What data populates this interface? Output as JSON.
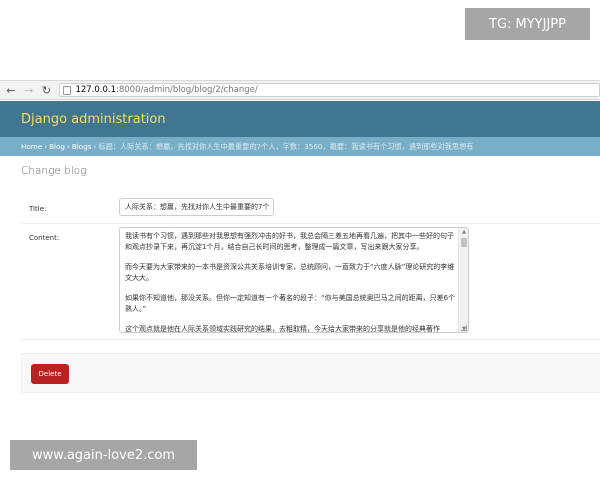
{
  "browser": {
    "back_icon": "←",
    "forward_icon": "→",
    "reload_icon": "↻",
    "url_host": "127.0.0.1",
    "url_path": ":8000/admin/blog/blog/2/change/"
  },
  "header": {
    "brand": "Django administration"
  },
  "breadcrumbs": {
    "items": [
      "Home",
      "Blog",
      "Blogs"
    ],
    "current": "标题：人际关系：想赢，先找对你人生中最重要的7个人，字数：3560，概要：我读书有个习惯，遇到那些对我思想有"
  },
  "main": {
    "page_title": "Change blog"
  },
  "form": {
    "title_label": "Title:",
    "title_value": "人际关系：想赢，先找对你人生中最重要的7个",
    "content_label": "Content:",
    "content_paragraphs": [
      "我读书有个习惯，遇到那些对我思想有强烈冲击的好书，我总会隔三差五地再看几遍，把其中一些好的句子和观点抄录下来，再沉淀1个月，结合自己长时间的思考，整理成一篇文章，写出来跟大家分享。",
      "而今天要为大家带来的一本书是资深公共关系培训专家，总统顾问，一直致力于“六度人脉”理论研究的李维文大大。",
      "如果你不知道他，那没关系。但你一定知道有一个著名的段子：“你与美国总统奥巴马之间的距离，只差6个熟人。”",
      "这个观点就是他在人际关系领域实践研究的结果，去粗取精，今天给大家带来的分享就是他的经典著作"
    ],
    "scroll_up": "▲",
    "scroll_down": "▼"
  },
  "actions": {
    "delete_label": "Delete"
  },
  "watermarks": {
    "top": "TG: MYYJJPP",
    "bottom": "www.again-love2.com"
  },
  "colors": {
    "header_bg": "#417690",
    "brand_text": "#f5dd5d",
    "breadcrumbs_bg": "#79aec8",
    "delete_bg": "#ba2121"
  }
}
